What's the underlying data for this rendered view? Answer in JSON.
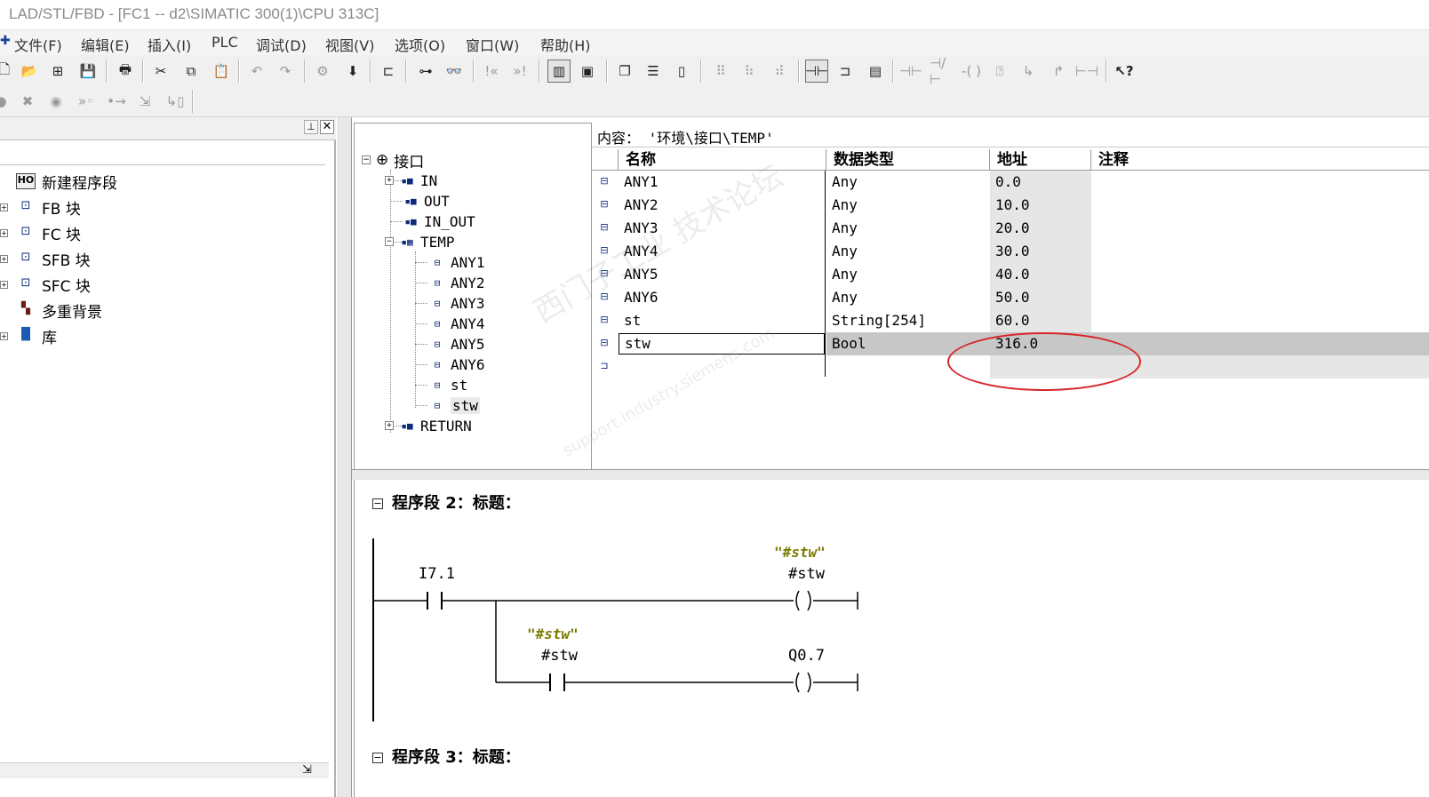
{
  "window": {
    "title": "LAD/STL/FBD  - [FC1 -- d2\\SIMATIC 300(1)\\CPU 313C]"
  },
  "menu": {
    "items": [
      "文件(F)",
      "编辑(E)",
      "插入(I)",
      "PLC",
      "调试(D)",
      "视图(V)",
      "选项(O)",
      "窗口(W)",
      "帮助(H)"
    ]
  },
  "left_tree": {
    "items": [
      {
        "label": "新建程序段",
        "icon": "new-network-icon"
      },
      {
        "label": "FB 块",
        "icon": "block-icon"
      },
      {
        "label": "FC 块",
        "icon": "block-icon"
      },
      {
        "label": "SFB 块",
        "icon": "block-icon"
      },
      {
        "label": "SFC 块",
        "icon": "block-icon"
      },
      {
        "label": "多重背景",
        "icon": "multi-instance-icon"
      },
      {
        "label": "库",
        "icon": "library-icon"
      }
    ]
  },
  "interface_tree": {
    "root": "接口",
    "nodes": [
      "IN",
      "OUT",
      "IN_OUT",
      "TEMP",
      "RETURN"
    ],
    "temp_children": [
      "ANY1",
      "ANY2",
      "ANY3",
      "ANY4",
      "ANY5",
      "ANY6",
      "st",
      "stw"
    ]
  },
  "content": {
    "path_label": "内容：  '环境\\接口\\TEMP'",
    "columns": {
      "name": "名称",
      "type": "数据类型",
      "address": "地址",
      "comment": "注释"
    },
    "rows": [
      {
        "name": "ANY1",
        "type": "Any",
        "address": "0.0"
      },
      {
        "name": "ANY2",
        "type": "Any",
        "address": "10.0"
      },
      {
        "name": "ANY3",
        "type": "Any",
        "address": "20.0"
      },
      {
        "name": "ANY4",
        "type": "Any",
        "address": "30.0"
      },
      {
        "name": "ANY5",
        "type": "Any",
        "address": "40.0"
      },
      {
        "name": "ANY6",
        "type": "Any",
        "address": "50.0"
      },
      {
        "name": "st",
        "type": "String[254]",
        "address": "60.0"
      },
      {
        "name": "stw",
        "type": "Bool",
        "address": "316.0"
      }
    ]
  },
  "ladder": {
    "segment2_title": "程序段  2：标题：",
    "segment3_title": "程序段  3：标题：",
    "contact1_addr": "I7.1",
    "coil1_symbol": "\"#stw\"",
    "coil1_addr": "#stw",
    "contact2_symbol": "\"#stw\"",
    "contact2_addr": "#stw",
    "coil2_addr": "Q0.7"
  },
  "watermark": {
    "line1": "西门子工业  技术论坛",
    "line2": "support.industry.siemens.com"
  },
  "colors": {
    "annotation": "#d8262b",
    "selected_row": "#c7c7c7",
    "symbol_text": "#7a7a00"
  }
}
